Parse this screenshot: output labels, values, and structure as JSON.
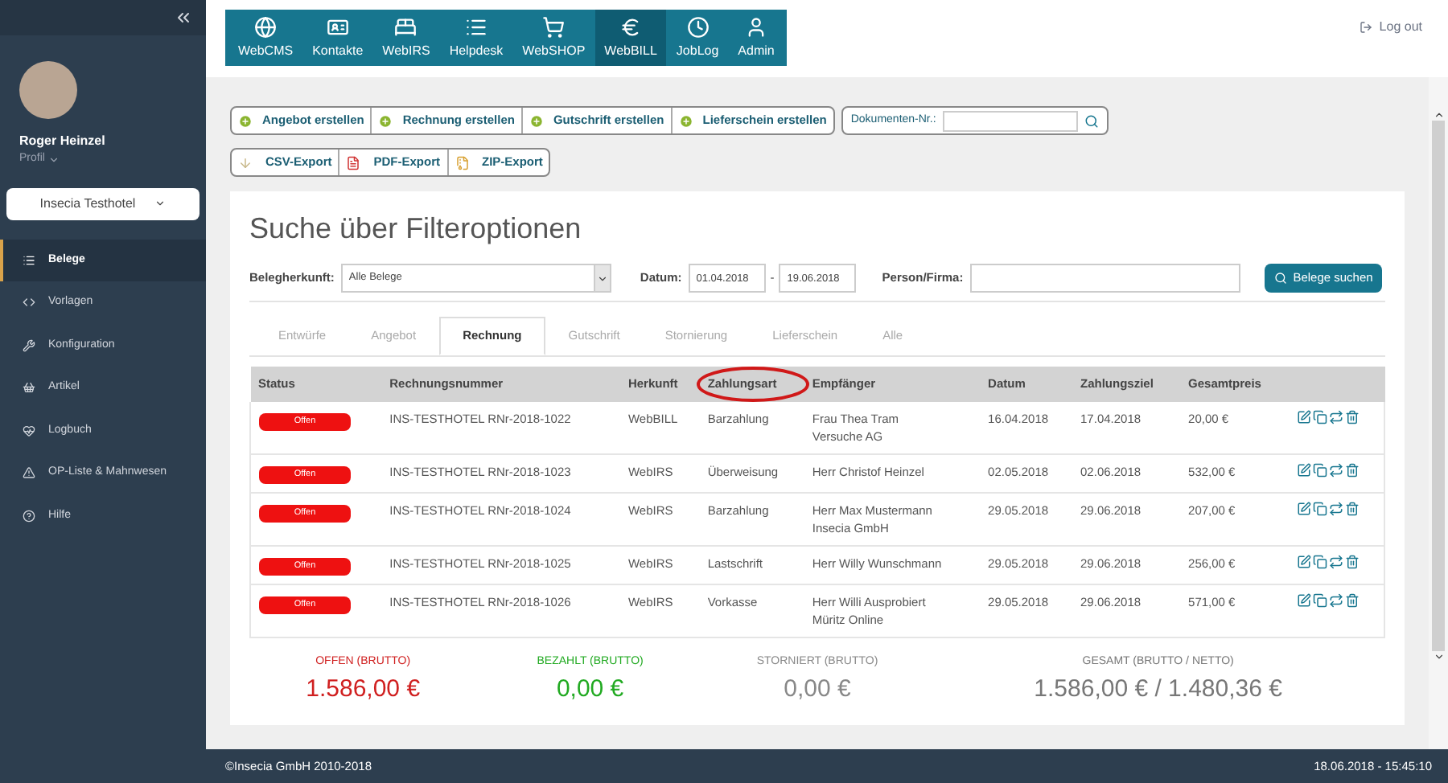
{
  "sidebar": {
    "user": {
      "name": "Roger Heinzel",
      "profile": "Profil"
    },
    "hotel_select": {
      "value": "Insecia Testhotel"
    },
    "items": [
      {
        "label": "Belege",
        "kind": "list",
        "selected": true
      },
      {
        "label": "Vorlagen",
        "kind": "code",
        "selected": false
      },
      {
        "label": "Konfiguration",
        "kind": "wrench",
        "selected": false
      },
      {
        "label": "Artikel",
        "kind": "basket",
        "selected": false
      },
      {
        "label": "Logbuch",
        "kind": "heart",
        "selected": false
      },
      {
        "label": "OP-Liste & Mahnwesen",
        "kind": "warning",
        "selected": false
      },
      {
        "label": "Hilfe",
        "kind": "help",
        "selected": false
      }
    ]
  },
  "app_nav": [
    {
      "label": "WebCMS",
      "kind": "globe",
      "selected": false
    },
    {
      "label": "Kontakte",
      "kind": "card",
      "selected": false
    },
    {
      "label": "WebIRS",
      "kind": "bed",
      "selected": false
    },
    {
      "label": "Helpdesk",
      "kind": "list",
      "selected": false
    },
    {
      "label": "WebSHOP",
      "kind": "cart",
      "selected": false
    },
    {
      "label": "WebBILL",
      "kind": "euro",
      "selected": true
    },
    {
      "label": "JobLog",
      "kind": "clock",
      "selected": false
    },
    {
      "label": "Admin",
      "kind": "user",
      "selected": false
    }
  ],
  "logout": "Log out",
  "create_buttons": [
    "Angebot erstellen",
    "Rechnung erstellen",
    "Gutschrift erstellen",
    "Lieferschein erstellen"
  ],
  "document_search": {
    "label": "Dokumenten-Nr.:"
  },
  "export_buttons": [
    {
      "label": "CSV-Export",
      "kind": "csv"
    },
    {
      "label": "PDF-Export",
      "kind": "pdf"
    },
    {
      "label": "ZIP-Export",
      "kind": "zip"
    }
  ],
  "title": "Suche über Filteroptionen",
  "filters": {
    "origin_label": "Belegherkunft:",
    "origin_value": "Alle Belege",
    "date_label": "Datum:",
    "date_from": "01.04.2018",
    "date_separator": "-",
    "date_to": "19.06.2018",
    "person_label": "Person/Firma:",
    "search_button": "Belege suchen"
  },
  "tabs": [
    {
      "label": "Entwürfe",
      "selected": false
    },
    {
      "label": "Angebot",
      "selected": false
    },
    {
      "label": "Rechnung",
      "selected": true
    },
    {
      "label": "Gutschrift",
      "selected": false
    },
    {
      "label": "Stornierung",
      "selected": false
    },
    {
      "label": "Lieferschein",
      "selected": false
    },
    {
      "label": "Alle",
      "selected": false
    }
  ],
  "table": {
    "columns": [
      {
        "label": "Status",
        "circled": false
      },
      {
        "label": "Rechnungsnummer",
        "circled": false
      },
      {
        "label": "Herkunft",
        "circled": false
      },
      {
        "label": "Zahlungsart",
        "circled": true
      },
      {
        "label": "Empfänger",
        "circled": false
      },
      {
        "label": "Datum",
        "circled": false
      },
      {
        "label": "Zahlungsziel",
        "circled": false
      },
      {
        "label": "Gesamtpreis",
        "circled": false
      }
    ],
    "rows": [
      {
        "status": "Offen",
        "number": "INS-TESTHOTEL RNr-2018-1022",
        "origin": "WebBILL",
        "payment": "Barzahlung",
        "recipient": [
          "Frau Thea Tram",
          "Versuche AG"
        ],
        "date": "16.04.2018",
        "due": "17.04.2018",
        "total": "20,00 €"
      },
      {
        "status": "Offen",
        "number": "INS-TESTHOTEL RNr-2018-1023",
        "origin": "WebIRS",
        "payment": "Überweisung",
        "recipient": [
          "Herr Christof Heinzel"
        ],
        "date": "02.05.2018",
        "due": "02.06.2018",
        "total": "532,00 €"
      },
      {
        "status": "Offen",
        "number": "INS-TESTHOTEL RNr-2018-1024",
        "origin": "WebIRS",
        "payment": "Barzahlung",
        "recipient": [
          "Herr Max Mustermann",
          "Insecia GmbH"
        ],
        "date": "29.05.2018",
        "due": "29.06.2018",
        "total": "207,00 €"
      },
      {
        "status": "Offen",
        "number": "INS-TESTHOTEL RNr-2018-1025",
        "origin": "WebIRS",
        "payment": "Lastschrift",
        "recipient": [
          "Herr Willy Wunschmann"
        ],
        "date": "29.05.2018",
        "due": "29.06.2018",
        "total": "256,00 €"
      },
      {
        "status": "Offen",
        "number": "INS-TESTHOTEL RNr-2018-1026",
        "origin": "WebIRS",
        "payment": "Vorkasse",
        "recipient": [
          "Herr Willi Ausprobiert",
          "Müritz Online"
        ],
        "date": "29.05.2018",
        "due": "29.06.2018",
        "total": "571,00 €"
      }
    ]
  },
  "totals": [
    {
      "label": "OFFEN (BRUTTO)",
      "value": "1.586,00 €",
      "color": "#d02020"
    },
    {
      "label": "BEZAHLT (BRUTTO)",
      "value": "0,00 €",
      "color": "#22aa22"
    },
    {
      "label": "STORNIERT (BRUTTO)",
      "value": "0,00 €",
      "color": "#888888"
    },
    {
      "label": "GESAMT (BRUTTO / NETTO)",
      "value": "1.586,00 € / 1.480,36 €",
      "color": "#777777"
    }
  ],
  "footer": {
    "copyright": "©Insecia GmbH 2010-2018",
    "datetime": "18.06.2018 - 15:45:10"
  }
}
